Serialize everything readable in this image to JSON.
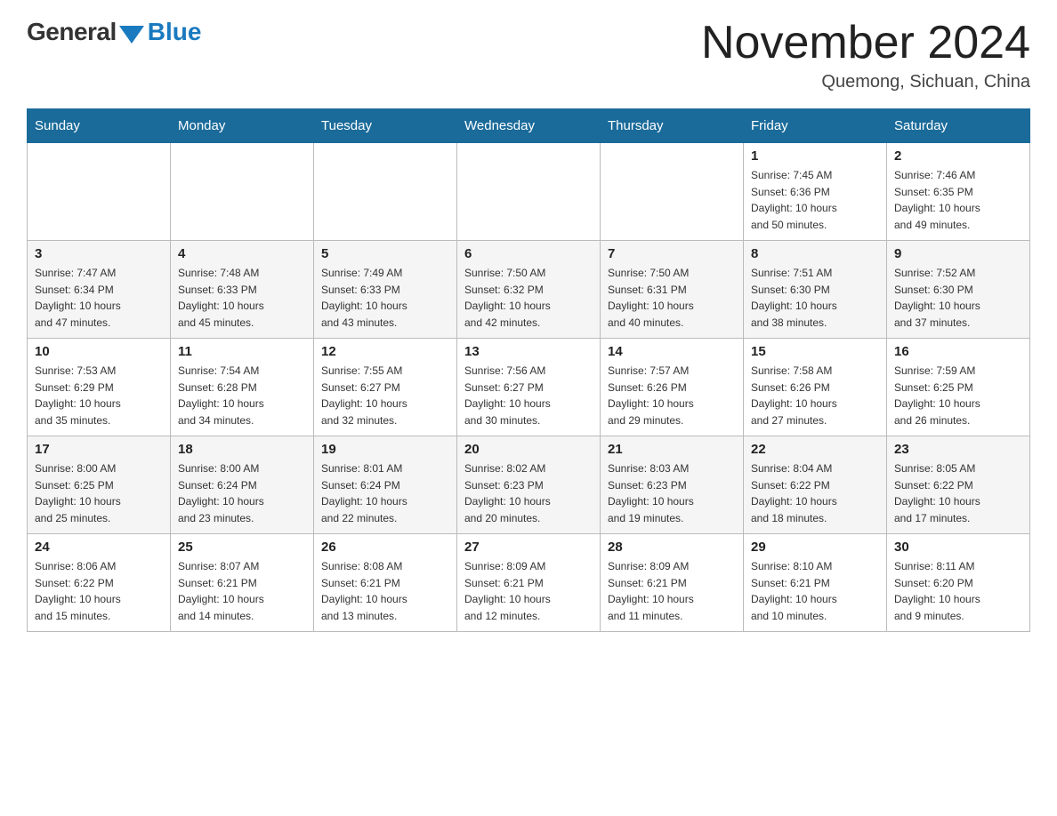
{
  "logo": {
    "general": "General",
    "blue": "Blue"
  },
  "header": {
    "month_year": "November 2024",
    "location": "Quemong, Sichuan, China"
  },
  "weekdays": [
    "Sunday",
    "Monday",
    "Tuesday",
    "Wednesday",
    "Thursday",
    "Friday",
    "Saturday"
  ],
  "weeks": [
    [
      {
        "day": "",
        "info": ""
      },
      {
        "day": "",
        "info": ""
      },
      {
        "day": "",
        "info": ""
      },
      {
        "day": "",
        "info": ""
      },
      {
        "day": "",
        "info": ""
      },
      {
        "day": "1",
        "info": "Sunrise: 7:45 AM\nSunset: 6:36 PM\nDaylight: 10 hours\nand 50 minutes."
      },
      {
        "day": "2",
        "info": "Sunrise: 7:46 AM\nSunset: 6:35 PM\nDaylight: 10 hours\nand 49 minutes."
      }
    ],
    [
      {
        "day": "3",
        "info": "Sunrise: 7:47 AM\nSunset: 6:34 PM\nDaylight: 10 hours\nand 47 minutes."
      },
      {
        "day": "4",
        "info": "Sunrise: 7:48 AM\nSunset: 6:33 PM\nDaylight: 10 hours\nand 45 minutes."
      },
      {
        "day": "5",
        "info": "Sunrise: 7:49 AM\nSunset: 6:33 PM\nDaylight: 10 hours\nand 43 minutes."
      },
      {
        "day": "6",
        "info": "Sunrise: 7:50 AM\nSunset: 6:32 PM\nDaylight: 10 hours\nand 42 minutes."
      },
      {
        "day": "7",
        "info": "Sunrise: 7:50 AM\nSunset: 6:31 PM\nDaylight: 10 hours\nand 40 minutes."
      },
      {
        "day": "8",
        "info": "Sunrise: 7:51 AM\nSunset: 6:30 PM\nDaylight: 10 hours\nand 38 minutes."
      },
      {
        "day": "9",
        "info": "Sunrise: 7:52 AM\nSunset: 6:30 PM\nDaylight: 10 hours\nand 37 minutes."
      }
    ],
    [
      {
        "day": "10",
        "info": "Sunrise: 7:53 AM\nSunset: 6:29 PM\nDaylight: 10 hours\nand 35 minutes."
      },
      {
        "day": "11",
        "info": "Sunrise: 7:54 AM\nSunset: 6:28 PM\nDaylight: 10 hours\nand 34 minutes."
      },
      {
        "day": "12",
        "info": "Sunrise: 7:55 AM\nSunset: 6:27 PM\nDaylight: 10 hours\nand 32 minutes."
      },
      {
        "day": "13",
        "info": "Sunrise: 7:56 AM\nSunset: 6:27 PM\nDaylight: 10 hours\nand 30 minutes."
      },
      {
        "day": "14",
        "info": "Sunrise: 7:57 AM\nSunset: 6:26 PM\nDaylight: 10 hours\nand 29 minutes."
      },
      {
        "day": "15",
        "info": "Sunrise: 7:58 AM\nSunset: 6:26 PM\nDaylight: 10 hours\nand 27 minutes."
      },
      {
        "day": "16",
        "info": "Sunrise: 7:59 AM\nSunset: 6:25 PM\nDaylight: 10 hours\nand 26 minutes."
      }
    ],
    [
      {
        "day": "17",
        "info": "Sunrise: 8:00 AM\nSunset: 6:25 PM\nDaylight: 10 hours\nand 25 minutes."
      },
      {
        "day": "18",
        "info": "Sunrise: 8:00 AM\nSunset: 6:24 PM\nDaylight: 10 hours\nand 23 minutes."
      },
      {
        "day": "19",
        "info": "Sunrise: 8:01 AM\nSunset: 6:24 PM\nDaylight: 10 hours\nand 22 minutes."
      },
      {
        "day": "20",
        "info": "Sunrise: 8:02 AM\nSunset: 6:23 PM\nDaylight: 10 hours\nand 20 minutes."
      },
      {
        "day": "21",
        "info": "Sunrise: 8:03 AM\nSunset: 6:23 PM\nDaylight: 10 hours\nand 19 minutes."
      },
      {
        "day": "22",
        "info": "Sunrise: 8:04 AM\nSunset: 6:22 PM\nDaylight: 10 hours\nand 18 minutes."
      },
      {
        "day": "23",
        "info": "Sunrise: 8:05 AM\nSunset: 6:22 PM\nDaylight: 10 hours\nand 17 minutes."
      }
    ],
    [
      {
        "day": "24",
        "info": "Sunrise: 8:06 AM\nSunset: 6:22 PM\nDaylight: 10 hours\nand 15 minutes."
      },
      {
        "day": "25",
        "info": "Sunrise: 8:07 AM\nSunset: 6:21 PM\nDaylight: 10 hours\nand 14 minutes."
      },
      {
        "day": "26",
        "info": "Sunrise: 8:08 AM\nSunset: 6:21 PM\nDaylight: 10 hours\nand 13 minutes."
      },
      {
        "day": "27",
        "info": "Sunrise: 8:09 AM\nSunset: 6:21 PM\nDaylight: 10 hours\nand 12 minutes."
      },
      {
        "day": "28",
        "info": "Sunrise: 8:09 AM\nSunset: 6:21 PM\nDaylight: 10 hours\nand 11 minutes."
      },
      {
        "day": "29",
        "info": "Sunrise: 8:10 AM\nSunset: 6:21 PM\nDaylight: 10 hours\nand 10 minutes."
      },
      {
        "day": "30",
        "info": "Sunrise: 8:11 AM\nSunset: 6:20 PM\nDaylight: 10 hours\nand 9 minutes."
      }
    ]
  ]
}
